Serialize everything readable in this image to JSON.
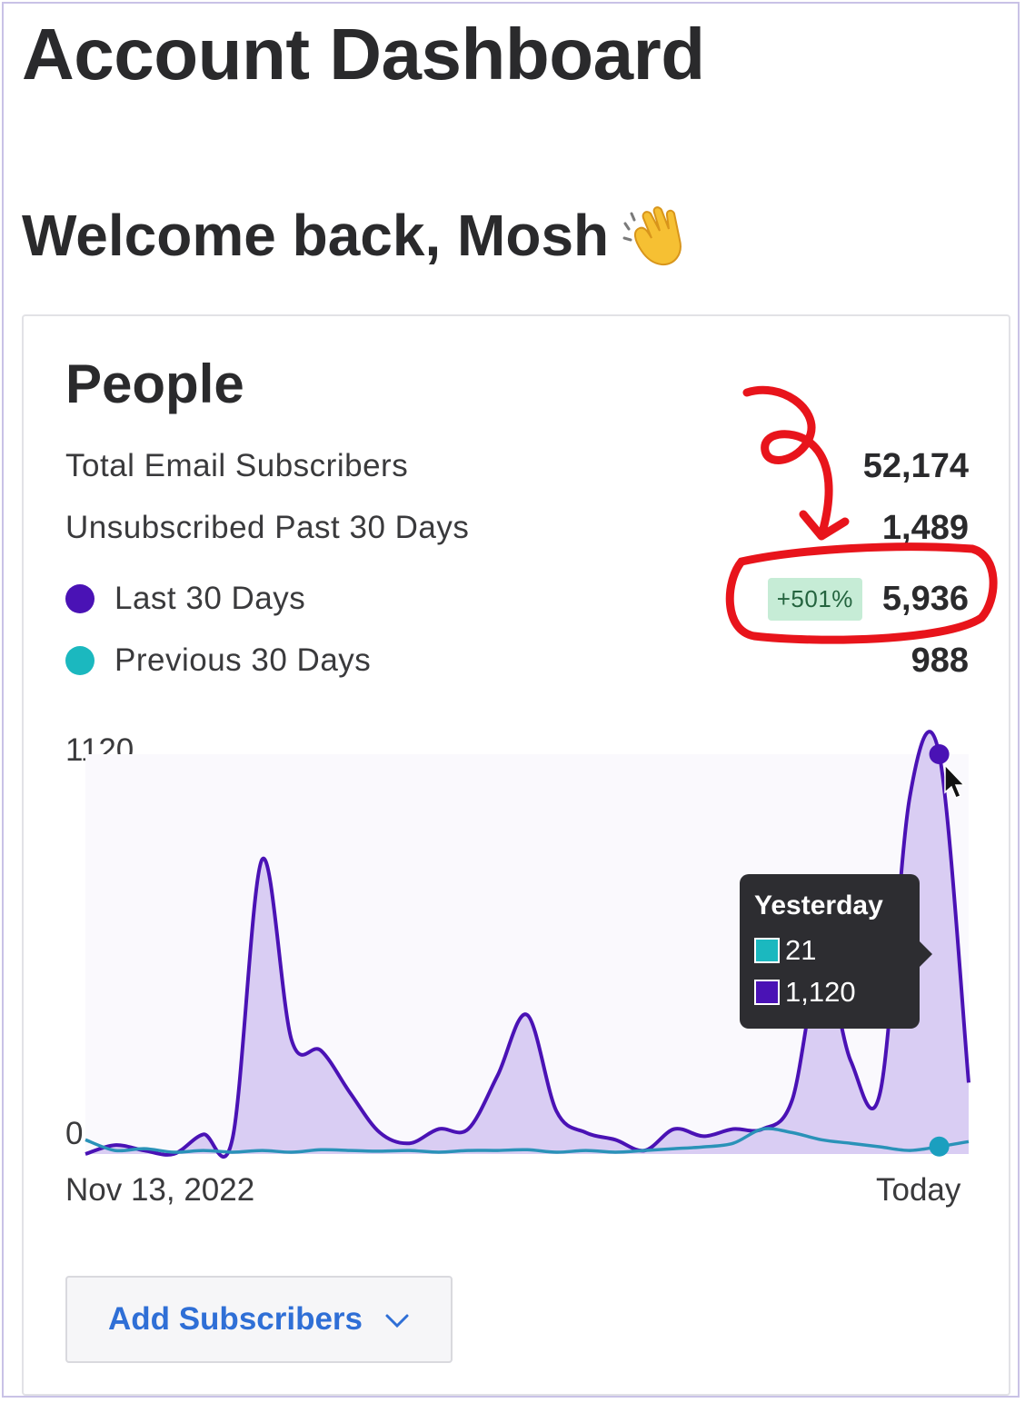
{
  "header": {
    "title": "Account Dashboard"
  },
  "welcome": {
    "text": "Welcome back, Mosh",
    "icon": "waving-hand-icon"
  },
  "people_card": {
    "title": "People",
    "stats": [
      {
        "label": "Total Email Subscribers",
        "value": "52,174"
      },
      {
        "label": "Unsubscribed Past 30 Days",
        "value": "1,489"
      },
      {
        "label": "Last 30 Days",
        "value": "5,936",
        "badge": "+501%",
        "dot_color": "#4a12b5"
      },
      {
        "label": "Previous 30 Days",
        "value": "988",
        "dot_color": "#1bb8bf"
      }
    ],
    "add_button": {
      "label": "Add Subscribers",
      "icon": "chevron-down-icon"
    }
  },
  "chart_data": {
    "type": "area",
    "y_top_label": "1120",
    "y_bottom_label": "0",
    "x_start_label": "Nov 13, 2022",
    "x_end_label": "Today",
    "ylim": [
      0,
      1120
    ],
    "grid": false,
    "x": [
      1,
      2,
      3,
      4,
      5,
      6,
      7,
      8,
      9,
      10,
      11,
      12,
      13,
      14,
      15,
      16,
      17,
      18,
      19,
      20,
      21,
      22,
      23,
      24,
      25,
      26,
      27,
      28,
      29,
      30,
      31
    ],
    "series": [
      {
        "color": "#4a12b5",
        "fill": "#d9cdf3",
        "values": [
          0,
          25,
          10,
          0,
          55,
          45,
          825,
          320,
          290,
          170,
          60,
          30,
          70,
          70,
          220,
          390,
          120,
          60,
          40,
          10,
          70,
          50,
          70,
          70,
          150,
          540,
          260,
          175,
          1000,
          1120,
          200
        ]
      },
      {
        "color": "#2a92b8",
        "values": [
          40,
          10,
          15,
          5,
          10,
          5,
          10,
          5,
          12,
          10,
          8,
          10,
          5,
          10,
          10,
          12,
          5,
          10,
          5,
          10,
          15,
          20,
          30,
          70,
          60,
          40,
          30,
          20,
          10,
          21,
          35
        ]
      }
    ],
    "tooltip": {
      "title": "Yesterday",
      "items": [
        {
          "value": "21",
          "color": "#1bb8bf"
        },
        {
          "value": "1,120",
          "color": "#4a12b5"
        }
      ]
    }
  },
  "annotation": {
    "color": "#e8141b"
  }
}
